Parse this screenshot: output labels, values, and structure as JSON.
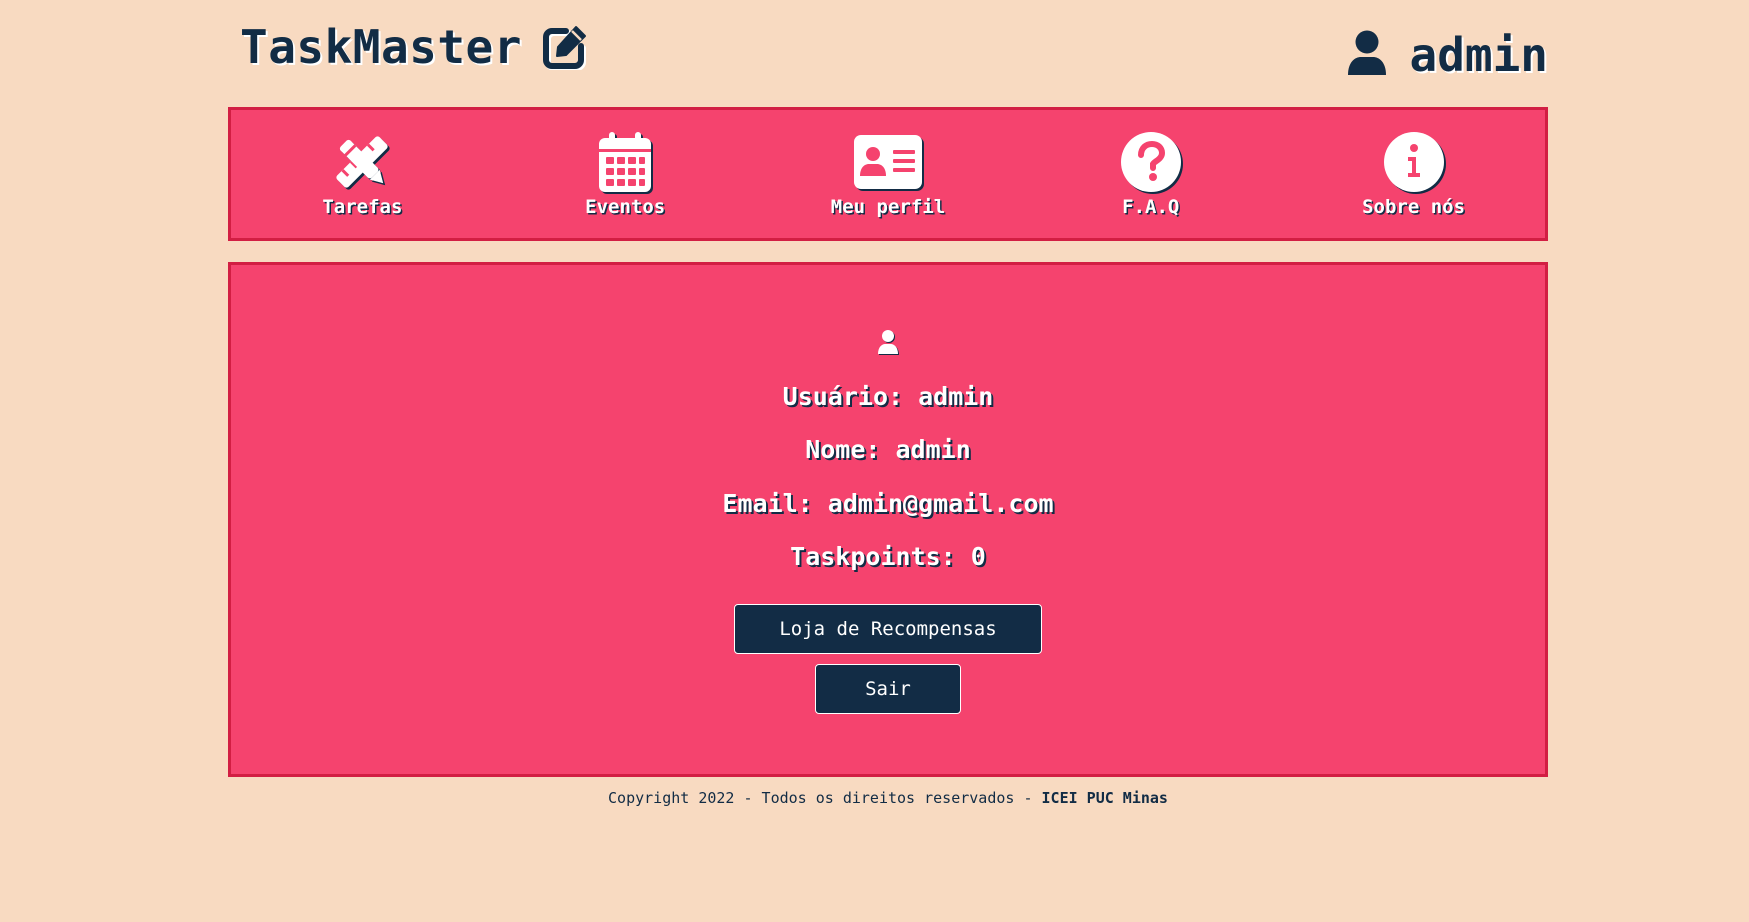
{
  "header": {
    "app_title": "TaskMaster",
    "title_icon": "edit-icon",
    "user_icon": "user-icon",
    "username": "admin"
  },
  "nav": {
    "items": [
      {
        "label": "Tarefas",
        "icon": "pencil-ruler-icon"
      },
      {
        "label": "Eventos",
        "icon": "calendar-icon"
      },
      {
        "label": "Meu perfil",
        "icon": "id-card-icon"
      },
      {
        "label": "F.A.Q",
        "icon": "question-circle-icon"
      },
      {
        "label": "Sobre nós",
        "icon": "info-circle-icon"
      }
    ]
  },
  "profile": {
    "icon": "user-icon",
    "usuario": "Usuário: admin",
    "nome": "Nome: admin",
    "email": "Email: admin@gmail.com",
    "taskpoints": "Taskpoints: 0",
    "store_button": "Loja de Recompensas",
    "exit_button": "Sair"
  },
  "footer": {
    "text": "Copyright 2022 - Todos os direitos reservados - ",
    "org": "ICEI PUC Minas"
  },
  "colors": {
    "background": "#f8dac1",
    "panel": "#f5436e",
    "panel_border": "#d21e43",
    "dark": "#122c45",
    "white": "#ffffff"
  }
}
